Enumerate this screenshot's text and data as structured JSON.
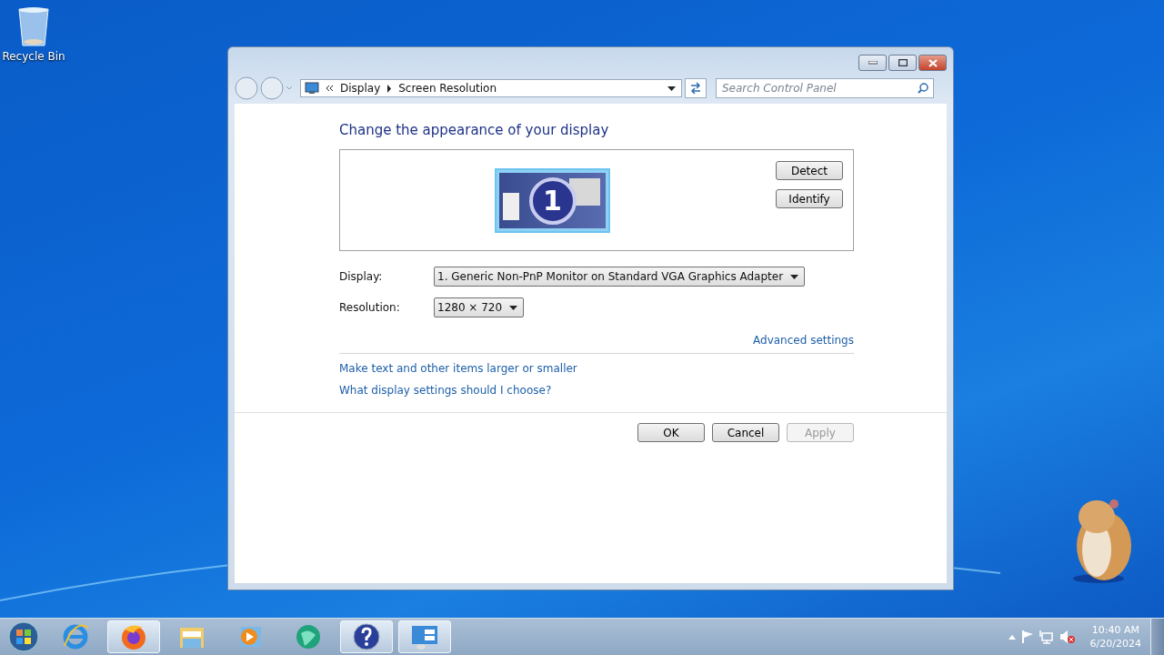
{
  "desktop": {
    "icons": [
      {
        "label": "Recycle Bin"
      }
    ]
  },
  "window": {
    "breadcrumb": [
      "Display",
      "Screen Resolution"
    ],
    "search": {
      "placeholder": "Search Control Panel"
    },
    "heading": "Change the appearance of your display",
    "monitor": {
      "number": "1",
      "selected": true
    },
    "side_buttons": [
      "Detect",
      "Identify"
    ],
    "fields": [
      {
        "label": "Display:",
        "value": "1. Generic Non-PnP Monitor on Standard VGA Graphics Adapter"
      },
      {
        "label": "Resolution:",
        "value": "1280 × 720"
      }
    ],
    "advanced_link": "Advanced settings",
    "links": [
      "Make text and other items larger or smaller",
      "What display settings should I choose?"
    ],
    "dialog_buttons": [
      {
        "label": "OK",
        "disabled": false
      },
      {
        "label": "Cancel",
        "disabled": false
      },
      {
        "label": "Apply",
        "disabled": true
      }
    ]
  },
  "taskbar": {
    "apps": [
      {
        "kind": "ie",
        "running": false
      },
      {
        "kind": "firefox",
        "running": true
      },
      {
        "kind": "folder",
        "running": false
      },
      {
        "kind": "media",
        "running": false
      },
      {
        "kind": "globe",
        "running": false
      },
      {
        "kind": "help",
        "running": true
      },
      {
        "kind": "control",
        "running": true
      }
    ],
    "clock": {
      "time": "10:40 AM",
      "date": "6/20/2024"
    }
  }
}
